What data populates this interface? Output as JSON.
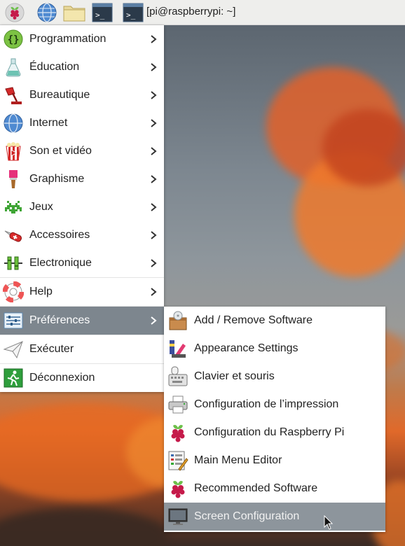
{
  "taskbar": {
    "terminal_window_title": "[pi@raspberrypi: ~]",
    "launchers": [
      "raspberry-menu-icon",
      "web-browser-icon",
      "file-manager-icon",
      "terminal-icon"
    ]
  },
  "main_menu": {
    "items": [
      {
        "label": "Programmation",
        "icon": "curly-braces-icon",
        "has_submenu": true
      },
      {
        "label": "Éducation",
        "icon": "flask-icon",
        "has_submenu": true
      },
      {
        "label": "Bureautique",
        "icon": "desk-lamp-icon",
        "has_submenu": true
      },
      {
        "label": "Internet",
        "icon": "globe-icon",
        "has_submenu": true
      },
      {
        "label": "Son et vidéo",
        "icon": "popcorn-icon",
        "has_submenu": true
      },
      {
        "label": "Graphisme",
        "icon": "paintbrush-icon",
        "has_submenu": true
      },
      {
        "label": "Jeux",
        "icon": "space-invader-icon",
        "has_submenu": true
      },
      {
        "label": "Accessoires",
        "icon": "swiss-knife-icon",
        "has_submenu": true
      },
      {
        "label": "Electronique",
        "icon": "electronics-icon",
        "has_submenu": true
      },
      {
        "label": "Help",
        "icon": "lifebuoy-icon",
        "has_submenu": true
      },
      {
        "label": "Préférences",
        "icon": "sliders-icon",
        "has_submenu": true,
        "active": true
      },
      {
        "label": "Exécuter",
        "icon": "paper-plane-icon",
        "has_submenu": false
      },
      {
        "label": "Déconnexion",
        "icon": "exit-icon",
        "has_submenu": false
      }
    ]
  },
  "preferences_submenu": {
    "items": [
      {
        "label": "Add / Remove Software",
        "icon": "package-icon"
      },
      {
        "label": "Appearance Settings",
        "icon": "palette-icon"
      },
      {
        "label": "Clavier et souris",
        "icon": "keyboard-mouse-icon"
      },
      {
        "label": "Configuration de l’impression",
        "icon": "printer-icon"
      },
      {
        "label": "Configuration du Raspberry Pi",
        "icon": "raspberry-icon"
      },
      {
        "label": "Main Menu Editor",
        "icon": "menu-editor-icon"
      },
      {
        "label": "Recommended Software",
        "icon": "raspberry-icon"
      },
      {
        "label": "Screen Configuration",
        "icon": "monitor-icon",
        "hovered": true
      }
    ]
  },
  "colors": {
    "panel_bg": "#eeeeec",
    "menu_bg": "#ffffff",
    "active_item_bg": "#7d868e",
    "raspberry_red": "#c51a4a",
    "leaf_green": "#6cc04a"
  }
}
